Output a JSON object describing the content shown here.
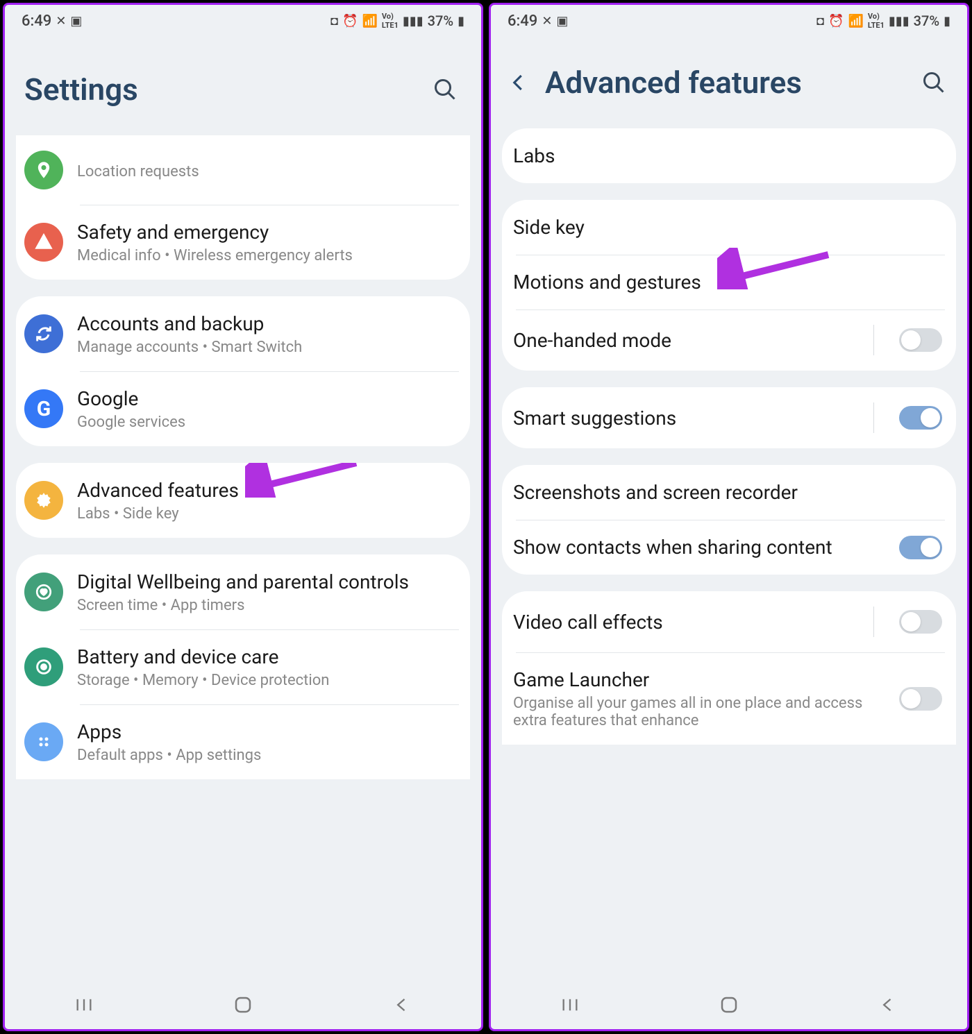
{
  "statusbar": {
    "time": "6:49",
    "battery": "37%"
  },
  "left": {
    "title": "Settings",
    "groups": [
      {
        "partial": "top",
        "rows": [
          {
            "title": "",
            "sub": "Location requests",
            "icon": "location",
            "iconColor": "ic-green"
          },
          {
            "title": "Safety and emergency",
            "sub": "Medical info  •  Wireless emergency alerts",
            "icon": "warning",
            "iconColor": "ic-red"
          }
        ]
      },
      {
        "rows": [
          {
            "title": "Accounts and backup",
            "sub": "Manage accounts  •  Smart Switch",
            "icon": "sync",
            "iconColor": "ic-blue"
          },
          {
            "title": "Google",
            "sub": "Google services",
            "icon": "G",
            "iconColor": "ic-gblue"
          }
        ]
      },
      {
        "rows": [
          {
            "title": "Advanced features",
            "sub": "Labs  •  Side key",
            "icon": "gear",
            "iconColor": "ic-yellow",
            "arrow": true
          }
        ]
      },
      {
        "partial": "bottom",
        "rows": [
          {
            "title": "Digital Wellbeing and parental controls",
            "sub": "Screen time  •  App timers",
            "icon": "heart",
            "iconColor": "ic-teal"
          },
          {
            "title": "Battery and device care",
            "sub": "Storage  •  Memory  •  Device protection",
            "icon": "ring",
            "iconColor": "ic-tealring"
          },
          {
            "title": "Apps",
            "sub": "Default apps  •  App settings",
            "icon": "grid",
            "iconColor": "ic-lblue"
          }
        ]
      }
    ]
  },
  "right": {
    "title": "Advanced features",
    "groups": [
      {
        "rows": [
          {
            "title": "Labs"
          }
        ]
      },
      {
        "rows": [
          {
            "title": "Side key"
          },
          {
            "title": "Motions and gestures",
            "arrow": true
          },
          {
            "title": "One-handed mode",
            "toggle": "off",
            "divider": true
          }
        ]
      },
      {
        "rows": [
          {
            "title": "Smart suggestions",
            "toggle": "on",
            "divider": true
          }
        ]
      },
      {
        "rows": [
          {
            "title": "Screenshots and screen recorder"
          },
          {
            "title": "Show contacts when sharing content",
            "toggle": "on"
          }
        ]
      },
      {
        "partial": "bottom",
        "rows": [
          {
            "title": "Video call effects",
            "toggle": "off",
            "divider": true
          },
          {
            "title": "Game Launcher",
            "sub": "Organise all your games all in one place and access extra features that enhance",
            "toggle": "off"
          }
        ]
      }
    ]
  }
}
